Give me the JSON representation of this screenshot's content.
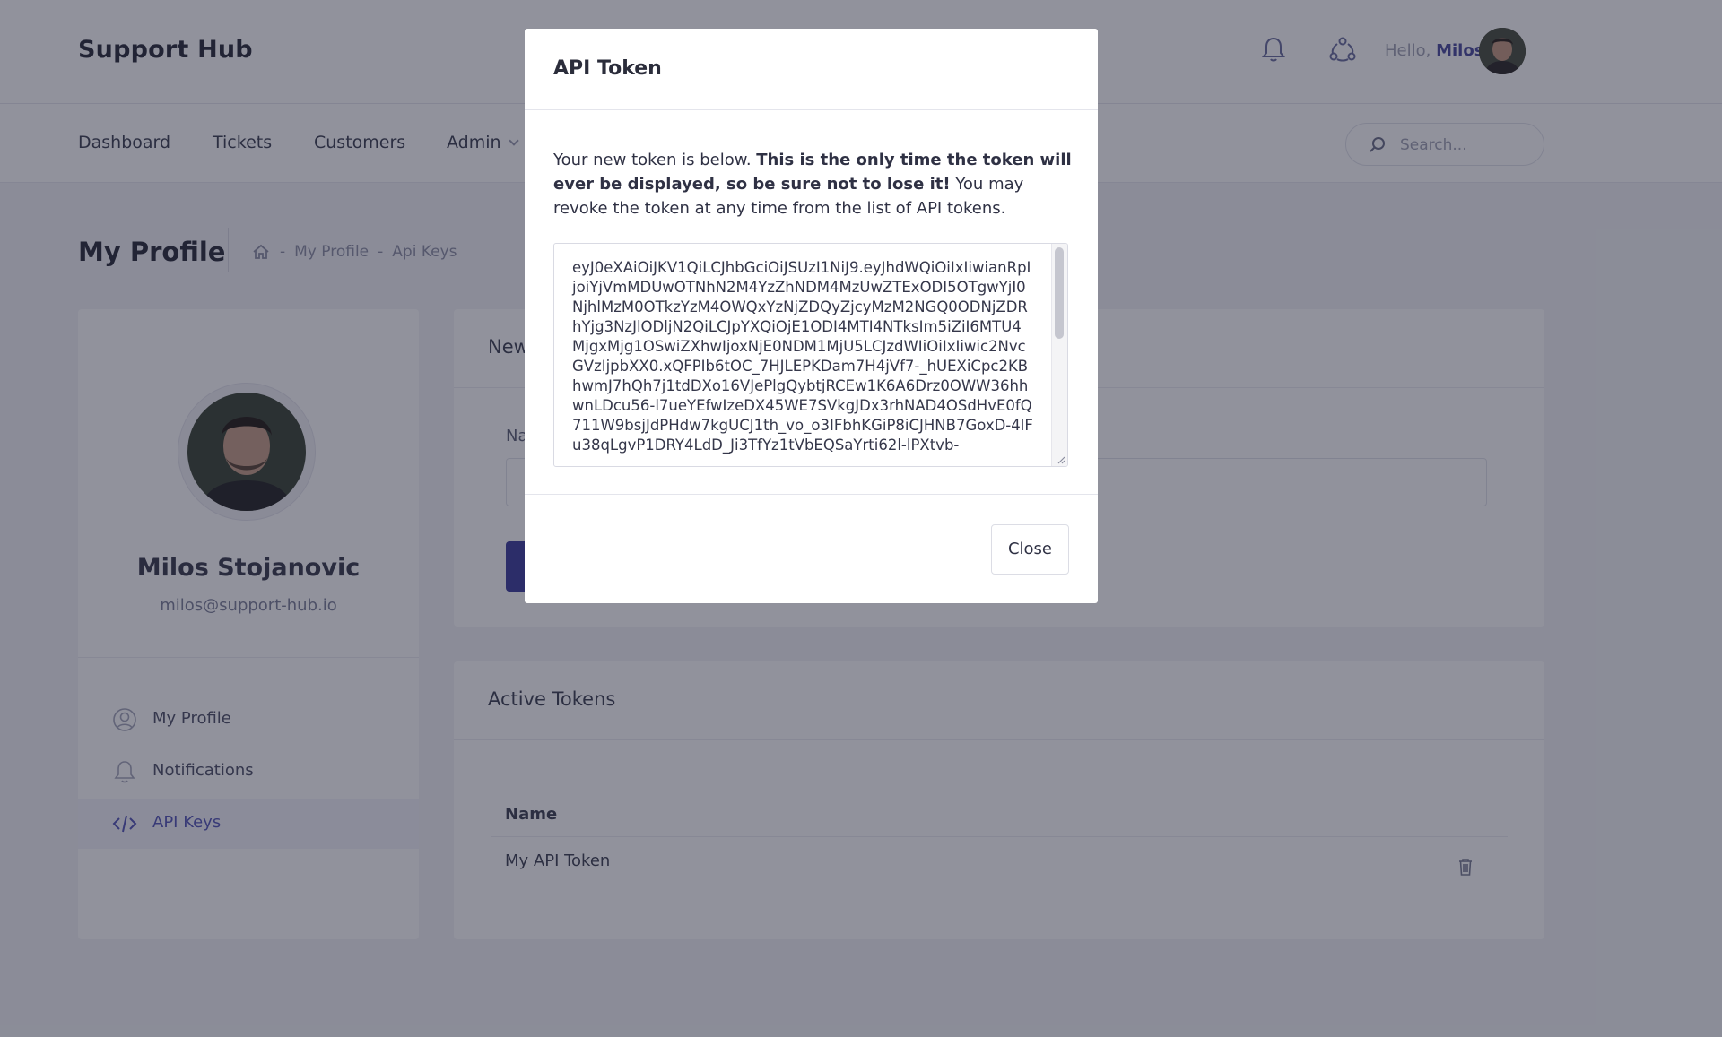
{
  "header": {
    "brand": "Support Hub",
    "greeting": "Hello,",
    "user_first_name": "Milos",
    "icons": [
      "bell-icon",
      "users-icon"
    ]
  },
  "nav": {
    "items": [
      {
        "label": "Dashboard"
      },
      {
        "label": "Tickets"
      },
      {
        "label": "Customers"
      },
      {
        "label": "Admin"
      }
    ],
    "search_placeholder": "Search..."
  },
  "subheader": {
    "title": "My Profile",
    "breadcrumb": [
      "My Profile",
      "Api Keys"
    ],
    "separator": "-"
  },
  "profile": {
    "name": "Milos Stojanovic",
    "email": "milos@support-hub.io",
    "menu": [
      {
        "label": "My Profile",
        "icon": "user-circle-icon",
        "active": false
      },
      {
        "label": "Notifications",
        "icon": "bell-icon",
        "active": false
      },
      {
        "label": "API Keys",
        "icon": "code-icon",
        "active": true
      }
    ]
  },
  "new_token_card": {
    "title": "New",
    "field_label": "Na"
  },
  "active_tokens": {
    "title": "Active Tokens",
    "columns": [
      "Name"
    ],
    "rows": [
      {
        "name": "My API Token"
      }
    ]
  },
  "modal": {
    "title": "API Token",
    "text_before": "Your new token is below. ",
    "text_bold": "This is the only time the token will ever be displayed, so be sure not to lose it!",
    "text_after": " You may revoke the token at any time from the list of API tokens.",
    "token": "eyJ0eXAiOiJKV1QiLCJhbGciOiJSUzI1NiJ9.eyJhdWQiOiIxIiwianRpIjoiYjVmMDUwOTNhN2M4YzZhNDM4MzUwZTExODI5OTgwYjI0NjhlMzM0OTkzYzM4OWQxYzNjZDQyZjcyMzM2NGQ0ODNjZDRhYjg3NzJlODljN2QiLCJpYXQiOjE1ODI4MTI4NTksIm5iZiI6MTU4MjgxMjg1OSwiZXhwIjoxNjE0NDM1MjU5LCJzdWIiOiIxIiwic2NvcGVzIjpbXX0.xQFPIb6tOC_7HJLEPKDam7H4jVf7-_hUEXiCpc2KBhwmJ7hQh7j1tdDXo16VJePlgQybtjRCEw1K6A6Drz0OWW36hhwnLDcu56-l7ueYEfwIzeDX45WE7SVkgJDx3rhNAD4OSdHvE0fQ711W9bsjJdPHdw7kgUCJ1th_vo_o3IFbhKGiP8iCJHNB7GoxD-4lFu38qLgvP1DRY4LdD_Ji3TfYz1tVbEQSaYrti62l-lPXtvb-",
    "close_label": "Close"
  },
  "colors": {
    "accent": "#4b4c9d",
    "overlay": "rgba(26,28,48,0.48)"
  }
}
